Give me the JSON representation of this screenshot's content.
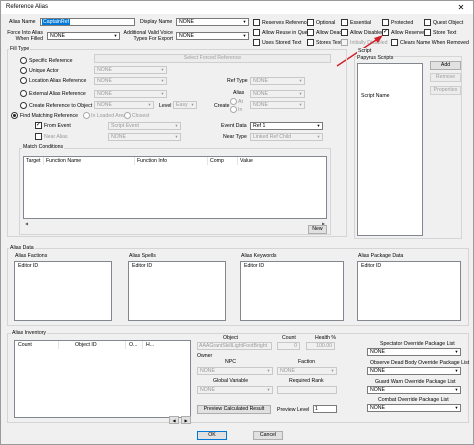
{
  "window": {
    "title": "Reference Alias",
    "close_glyph": "✕"
  },
  "top": {
    "alias_name_label": "Alias Name",
    "alias_name_value": "CaptainRef",
    "display_name_label": "Display Name",
    "display_name_value": "NONE",
    "force_into_label_1": "Force Into Alias",
    "force_into_label_2": "When Filled",
    "force_into_value": "NONE",
    "voice_label_1": "Additional Valid Voice",
    "voice_label_2": "Types For Export",
    "voice_value": "NONE"
  },
  "flags": [
    {
      "label": "Reserves Reference",
      "checked": false
    },
    {
      "label": "Optional",
      "checked": false
    },
    {
      "label": "Essential",
      "checked": false
    },
    {
      "label": "Protected",
      "checked": false
    },
    {
      "label": "Quest Object",
      "checked": false
    },
    {
      "label": "Allow Reuse in Quest",
      "checked": false
    },
    {
      "label": "Allow Dead",
      "checked": false
    },
    {
      "label": "Allow Disabled",
      "checked": false
    },
    {
      "label": "Allow Reserved",
      "checked": true
    },
    {
      "label": "Store Text",
      "checked": false
    },
    {
      "label": "Uses Stored Text",
      "checked": false
    },
    {
      "label": "Stores Text",
      "checked": false
    },
    {
      "label": "Initially Disabled",
      "checked": false
    },
    {
      "label": "Clears Name When Removed",
      "checked": false
    }
  ],
  "fill_type": {
    "title": "Fill Type",
    "specific_reference": "Specific Reference",
    "select_forced_reference": "Select Forced Reference",
    "unique_actor": "Unique Actor",
    "unique_actor_value": "NONE",
    "location_alias_reference": "Location Alias Reference",
    "location_alias_value": "NONE",
    "ref_type_label": "Ref Type",
    "ref_type_value": "NONE",
    "external_alias_reference": "External Alias Reference",
    "external_alias_value": "NONE",
    "alias_label": "Alias",
    "alias_value": "NONE",
    "create_reference": "Create Reference to Object",
    "create_ref_value": "NONE",
    "level_label": "Level",
    "level_value": "Easy",
    "create_label": "Create",
    "at_label": "At",
    "in_label": "In",
    "find_matching_reference": "Find Matching Reference",
    "in_loaded_area": "In Loaded Area",
    "closest": "Closest",
    "from_event": "From Event",
    "from_event_value": "Script Event",
    "event_data_label": "Event Data",
    "event_data_value": "Ref 1",
    "near_alias": "Near Alias",
    "near_alias_value": "NONE",
    "near_type_label": "Near Type",
    "near_type_value": "Linked Ref Child",
    "match_conditions_title": "Match Conditions",
    "conditions_columns": [
      "Target",
      "Function Name",
      "Function Info",
      "Comp",
      "Value"
    ],
    "new_button": "New"
  },
  "scripts": {
    "title_1": "Script",
    "title_2": "Papyrus Scripts",
    "column": "Script Name",
    "add": "Add",
    "remove": "Remove",
    "properties": "Properties"
  },
  "alias_data": {
    "title": "Alias Data",
    "factions_title": "Alias Factions",
    "factions_column": "Editor ID",
    "spells_title": "Alias Spells",
    "spells_column": "Editor ID",
    "keywords_title": "Alias Keywords",
    "keywords_column": "Editor ID",
    "package_title": "Alias Package Data",
    "package_column": "Editor ID"
  },
  "inventory": {
    "title": "Alias Inventory",
    "columns": [
      "Count",
      "Object ID",
      "O...",
      "H..."
    ]
  },
  "object_panel": {
    "object_label": "Object",
    "object_value": "AAAGrantSkillLightFootBright",
    "count_label": "Count",
    "count_value": "0",
    "health_label": "Health %",
    "health_value": "100.00",
    "owner_label": "Owner",
    "npc_label": "NPC",
    "npc_value": "NONE",
    "faction_label": "Faction",
    "faction_value": "NONE",
    "global_label": "Global Variable",
    "global_value": "NONE",
    "required_rank_label": "Required Rank",
    "required_rank_value": "",
    "preview_button": "Preview Calculated Result",
    "preview_level_label": "Preview Level",
    "preview_level_value": "1"
  },
  "package_lists": {
    "spectator_label": "Spectator Override Package List",
    "spectator_value": "NONE",
    "observe_label": "Observe Dead Body Override Package List",
    "observe_value": "NONE",
    "guard_label": "Guard Warn Override Package List",
    "guard_value": "NONE",
    "combat_label": "Combat Override Package List",
    "combat_value": "NONE"
  },
  "footer": {
    "ok": "OK",
    "cancel": "Cancel"
  },
  "colors": {
    "annotation_arrow": "#d0202a",
    "selection": "#0078d7"
  }
}
